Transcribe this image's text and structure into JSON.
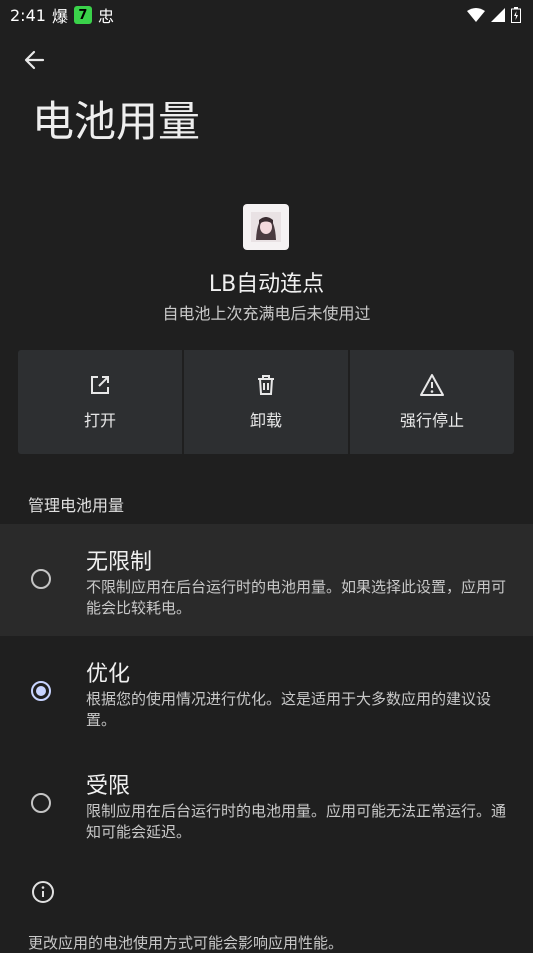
{
  "status_bar": {
    "time": "2:41",
    "notif_1": "爆",
    "notif_2": "7",
    "notif_3": "忠"
  },
  "page": {
    "title": "电池用量"
  },
  "app": {
    "name": "LB自动连点",
    "subtitle": "自电池上次充满电后未使用过"
  },
  "actions": [
    {
      "label": "打开",
      "icon": "open-external-icon"
    },
    {
      "label": "卸载",
      "icon": "trash-icon"
    },
    {
      "label": "强行停止",
      "icon": "warning-icon"
    }
  ],
  "section": {
    "header": "管理电池用量"
  },
  "options": [
    {
      "title": "无限制",
      "desc": "不限制应用在后台运行时的电池用量。如果选择此设置，应用可能会比较耗电。",
      "selected": false
    },
    {
      "title": "优化",
      "desc": "根据您的使用情况进行优化。这是适用于大多数应用的建议设置。",
      "selected": true
    },
    {
      "title": "受限",
      "desc": "限制应用在后台运行时的电池用量。应用可能无法正常运行。通知可能会延迟。",
      "selected": false
    }
  ],
  "footer": {
    "text": "更改应用的电池使用方式可能会影响应用性能。"
  },
  "colors": {
    "background": "#1f1f1f",
    "button_bg": "#2d2f31",
    "accent": "#c8d4ff"
  }
}
